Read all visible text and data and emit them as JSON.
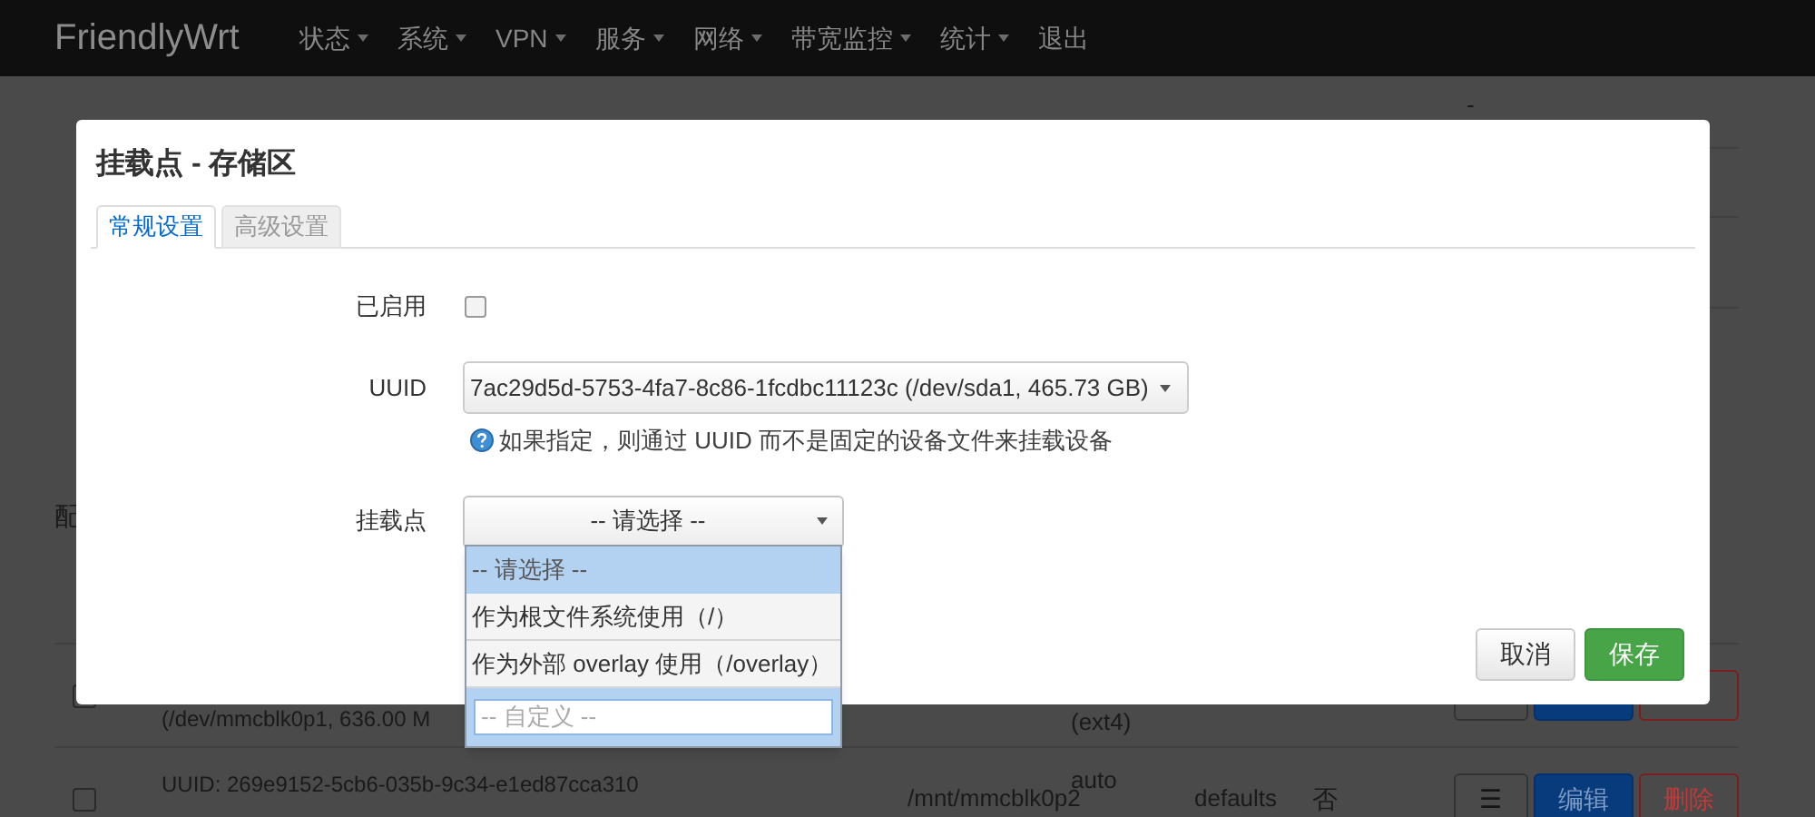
{
  "navbar": {
    "brand": "FriendlyWrt",
    "menu": [
      {
        "label": "状态",
        "dropdown": true
      },
      {
        "label": "系统",
        "dropdown": true
      },
      {
        "label": "VPN",
        "dropdown": true
      },
      {
        "label": "服务",
        "dropdown": true
      },
      {
        "label": "网络",
        "dropdown": true
      },
      {
        "label": "带宽监控",
        "dropdown": true
      },
      {
        "label": "统计",
        "dropdown": true
      },
      {
        "label": "退出",
        "dropdown": false
      }
    ]
  },
  "storage_table": {
    "rows": [
      {
        "cells": [
          "",
          "",
          "",
          "",
          "-"
        ]
      }
    ]
  },
  "section_description": "配",
  "mount_table": {
    "rows": [
      {
        "checked": false,
        "device": [
          "(/dev/mmcblk0p1, 636.00 M"
        ],
        "mount_point": "",
        "filesystem": [
          "(ext4)"
        ],
        "options": "",
        "enabled": "",
        "actions": [
          {
            "kind": "menu"
          },
          {
            "kind": "edit"
          },
          {
            "kind": "delete"
          }
        ]
      },
      {
        "checked": false,
        "device": [
          "UUID: 269e9152-5cb6-035b-9c34-e1ed87cca310"
        ],
        "mount_point": "/mnt/mmcblk0p2",
        "filesystem": [
          "auto"
        ],
        "options": "defaults",
        "enabled": "否",
        "actions": [
          {
            "kind": "menu",
            "label": "☰"
          },
          {
            "kind": "edit",
            "label": "编辑"
          },
          {
            "kind": "delete",
            "label": "删除"
          }
        ]
      }
    ]
  },
  "dialog": {
    "title": "挂载点 - 存储区",
    "tabs": [
      {
        "label": "常规设置",
        "selected": true
      },
      {
        "label": "高级设置",
        "selected": false
      }
    ],
    "fields": [
      {
        "kind": "checkbox",
        "label": "已启用",
        "checked": false
      },
      {
        "kind": "select",
        "label": "UUID",
        "value": "7ac29d5d-5753-4fa7-8c86-1fcdbc11123c (/dev/sda1, 465.73 GB)",
        "help": "如果指定，则通过 UUID 而不是固定的设备文件来挂载设备"
      },
      {
        "kind": "combo",
        "label": "挂载点",
        "value": "-- 请选择 --",
        "expanded": true,
        "options": [
          {
            "label": "-- 请选择 --",
            "selected": true
          },
          {
            "label": "作为根文件系统使用（/）",
            "selected": false
          },
          {
            "label": "作为外部 overlay 使用（/overlay）",
            "selected": false
          }
        ],
        "custom_placeholder": "-- 自定义 --"
      }
    ],
    "buttons": [
      {
        "label": "取消",
        "kind": "cancel"
      },
      {
        "label": "保存",
        "kind": "primary"
      }
    ]
  }
}
